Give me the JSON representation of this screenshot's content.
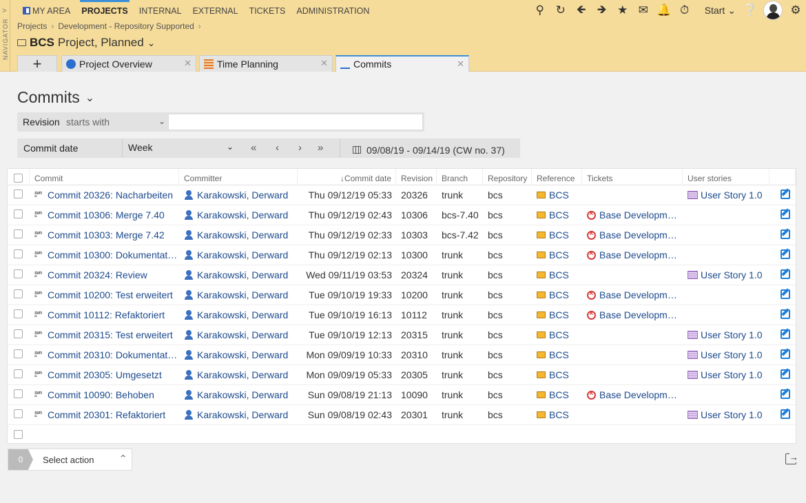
{
  "nav": {
    "label": "NAVIGATOR",
    "items": [
      "MY AREA",
      "PROJECTS",
      "INTERNAL",
      "EXTERNAL",
      "TICKETS",
      "ADMINISTRATION"
    ]
  },
  "toolbar": {
    "start_label": "Start"
  },
  "breadcrumb": [
    "Projects",
    "Development - Repository Supported"
  ],
  "project": {
    "code": "BCS",
    "title": "Project, Planned"
  },
  "tabs": [
    {
      "label": "Project Overview"
    },
    {
      "label": "Time Planning"
    },
    {
      "label": "Commits"
    }
  ],
  "page": {
    "title": "Commits"
  },
  "filter_revision": {
    "label": "Revision",
    "operator": "starts with",
    "value": ""
  },
  "filter_date": {
    "label": "Commit date",
    "period": "Week",
    "range": "09/08/19 - 09/14/19 (CW no. 37)"
  },
  "columns": [
    "Commit",
    "Committer",
    "Commit date",
    "Revision",
    "Branch",
    "Repository",
    "Reference",
    "Tickets",
    "User stories"
  ],
  "rows": [
    {
      "commit": "Commit 20326: Nacharbeiten",
      "committer": "Karakowski, Derward",
      "date": "Thu 09/12/19 05:33",
      "revision": "20326",
      "branch": "trunk",
      "repo": "bcs",
      "ref": "BCS",
      "ticket": "",
      "story": "User Story 1.0"
    },
    {
      "commit": "Commit 10306: Merge 7.40",
      "committer": "Karakowski, Derward",
      "date": "Thu 09/12/19 02:43",
      "revision": "10306",
      "branch": "bcs-7.40",
      "repo": "bcs",
      "ref": "BCS",
      "ticket": "Base Developm…",
      "story": ""
    },
    {
      "commit": "Commit 10303: Merge 7.42",
      "committer": "Karakowski, Derward",
      "date": "Thu 09/12/19 02:33",
      "revision": "10303",
      "branch": "bcs-7.42",
      "repo": "bcs",
      "ref": "BCS",
      "ticket": "Base Developm…",
      "story": ""
    },
    {
      "commit": "Commit 10300: Dokumentat…",
      "committer": "Karakowski, Derward",
      "date": "Thu 09/12/19 02:13",
      "revision": "10300",
      "branch": "trunk",
      "repo": "bcs",
      "ref": "BCS",
      "ticket": "Base Developm…",
      "story": ""
    },
    {
      "commit": "Commit 20324: Review",
      "committer": "Karakowski, Derward",
      "date": "Wed 09/11/19 03:53",
      "revision": "20324",
      "branch": "trunk",
      "repo": "bcs",
      "ref": "BCS",
      "ticket": "",
      "story": "User Story 1.0"
    },
    {
      "commit": "Commit 10200: Test erweitert",
      "committer": "Karakowski, Derward",
      "date": "Tue 09/10/19 19:33",
      "revision": "10200",
      "branch": "trunk",
      "repo": "bcs",
      "ref": "BCS",
      "ticket": "Base Developm…",
      "story": ""
    },
    {
      "commit": "Commit 10112: Refaktoriert",
      "committer": "Karakowski, Derward",
      "date": "Tue 09/10/19 16:13",
      "revision": "10112",
      "branch": "trunk",
      "repo": "bcs",
      "ref": "BCS",
      "ticket": "Base Developm…",
      "story": ""
    },
    {
      "commit": "Commit 20315: Test erweitert",
      "committer": "Karakowski, Derward",
      "date": "Tue 09/10/19 12:13",
      "revision": "20315",
      "branch": "trunk",
      "repo": "bcs",
      "ref": "BCS",
      "ticket": "",
      "story": "User Story 1.0"
    },
    {
      "commit": "Commit 20310: Dokumentat…",
      "committer": "Karakowski, Derward",
      "date": "Mon 09/09/19 10:33",
      "revision": "20310",
      "branch": "trunk",
      "repo": "bcs",
      "ref": "BCS",
      "ticket": "",
      "story": "User Story 1.0"
    },
    {
      "commit": "Commit 20305: Umgesetzt",
      "committer": "Karakowski, Derward",
      "date": "Mon 09/09/19 05:33",
      "revision": "20305",
      "branch": "trunk",
      "repo": "bcs",
      "ref": "BCS",
      "ticket": "",
      "story": "User Story 1.0"
    },
    {
      "commit": "Commit 10090: Behoben",
      "committer": "Karakowski, Derward",
      "date": "Sun 09/08/19 21:13",
      "revision": "10090",
      "branch": "trunk",
      "repo": "bcs",
      "ref": "BCS",
      "ticket": "Base Developm…",
      "story": ""
    },
    {
      "commit": "Commit 20301: Refaktoriert",
      "committer": "Karakowski, Derward",
      "date": "Sun 09/08/19 02:43",
      "revision": "20301",
      "branch": "trunk",
      "repo": "bcs",
      "ref": "BCS",
      "ticket": "",
      "story": "User Story 1.0"
    }
  ],
  "footer": {
    "selected_count": "0",
    "action_label": "Select action"
  }
}
